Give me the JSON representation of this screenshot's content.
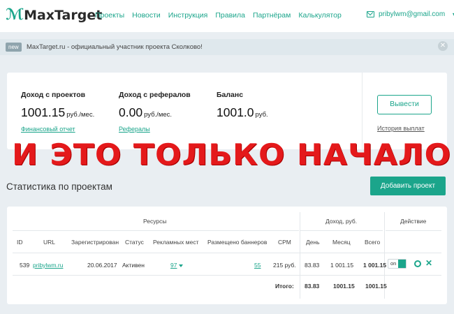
{
  "header": {
    "logo": "MaxTarget",
    "nav": [
      "Проекты",
      "Новости",
      "Инструкция",
      "Правила",
      "Партнёрам",
      "Калькулятор"
    ],
    "email": "pribylwm@gmail.com"
  },
  "notice": {
    "badge": "new",
    "text": "MaxTarget.ru - официальный участник проекта Сколково!"
  },
  "income": {
    "projects": {
      "label": "Доход с проектов",
      "value": "1001.15",
      "unit": "руб./мес.",
      "link": "Финансовый отчет"
    },
    "referrals": {
      "label": "Доход с рефералов",
      "value": "0.00",
      "unit": "руб./мес.",
      "link": "Рефералы"
    },
    "balance": {
      "label": "Баланс",
      "value": "1001.0",
      "unit": "руб."
    },
    "withdraw_label": "Вывести",
    "history_link": "История выплат"
  },
  "overlay_text": "И ЭТО ТОЛЬКО НАЧАЛО!",
  "section": {
    "title": "Статистика по проектам",
    "add_button": "Добавить проект"
  },
  "table": {
    "group_headers": {
      "resources": "Ресурсы",
      "income": "Доход, руб.",
      "action": "Действие"
    },
    "columns": [
      "ID",
      "URL",
      "Зарегистрирован",
      "Статус",
      "Рекламных мест",
      "Размещено баннеров",
      "CPM",
      "День",
      "Месяц",
      "Всего"
    ],
    "row": {
      "id": "539",
      "url": "pribylwm.ru",
      "registered": "20.06.2017",
      "status": "Активен",
      "ad_places": "97",
      "banners": "55",
      "cpm": "215 руб.",
      "day": "83.83",
      "month": "1 001.15",
      "total": "1 001.15",
      "toggle": "on"
    },
    "totals": {
      "label": "Итого:",
      "day": "83.83",
      "month": "1001.15",
      "total": "1001.15"
    }
  },
  "colors": {
    "accent": "#1ba58b",
    "overlay": "#e4191b"
  }
}
